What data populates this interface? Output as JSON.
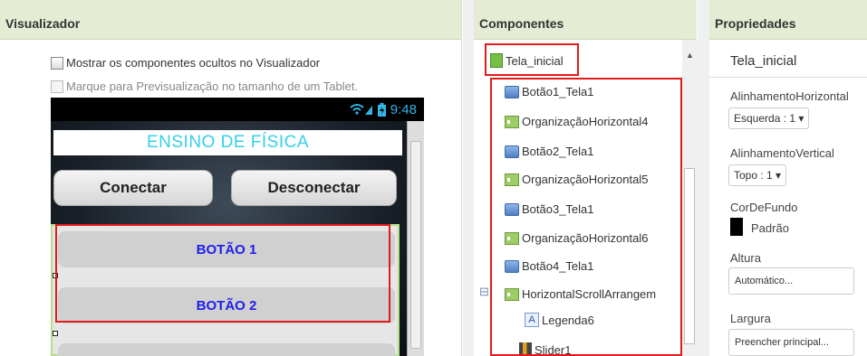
{
  "viewer": {
    "title": "Visualizador",
    "show_hidden_label": "Mostrar os componentes ocultos no Visualizador",
    "tablet_preview_label": "Marque para Previsualização no tamanho de um Tablet.",
    "phone": {
      "clock": "9:48",
      "screen_title": "ENSINO DE FÍSICA",
      "connect_label": "Conectar",
      "disconnect_label": "Desconectar",
      "button1_label": "BOTÃO 1",
      "button2_label": "BOTÃO 2"
    }
  },
  "components": {
    "title": "Componentes",
    "root": "Tela_inicial",
    "items": [
      {
        "label": "Botão1_Tela1",
        "icon": "button-icon"
      },
      {
        "label": "OrganizaçãoHorizontal4",
        "icon": "horizontal-arrangement-icon"
      },
      {
        "label": "Botão2_Tela1",
        "icon": "button-icon"
      },
      {
        "label": "OrganizaçãoHorizontal5",
        "icon": "horizontal-arrangement-icon"
      },
      {
        "label": "Botão3_Tela1",
        "icon": "button-icon"
      },
      {
        "label": "OrganizaçãoHorizontal6",
        "icon": "horizontal-arrangement-icon"
      },
      {
        "label": "Botão4_Tela1",
        "icon": "button-icon"
      },
      {
        "label": "HorizontalScrollArrangem",
        "icon": "horizontal-arrangement-icon"
      },
      {
        "label": "Legenda6",
        "icon": "label-icon"
      },
      {
        "label": "Slider1",
        "icon": "slider-icon"
      }
    ]
  },
  "properties": {
    "title": "Propriedades",
    "selected": "Tela_inicial",
    "align_horizontal_label": "AlinhamentoHorizontal",
    "align_horizontal_value": "Esquerda : 1 ▾",
    "align_vertical_label": "AlinhamentoVertical",
    "align_vertical_value": "Topo : 1 ▾",
    "bg_color_label": "CorDeFundo",
    "bg_color_value": "Padrão",
    "height_label": "Altura",
    "height_value": "Automático...",
    "width_label": "Largura",
    "width_value": "Preencher principal..."
  },
  "colors": {
    "header_bg": "#e4ecd4",
    "highlight_red": "#e21a1a",
    "title_cyan": "#35d0e8",
    "button_text_blue": "#1d1df0"
  }
}
